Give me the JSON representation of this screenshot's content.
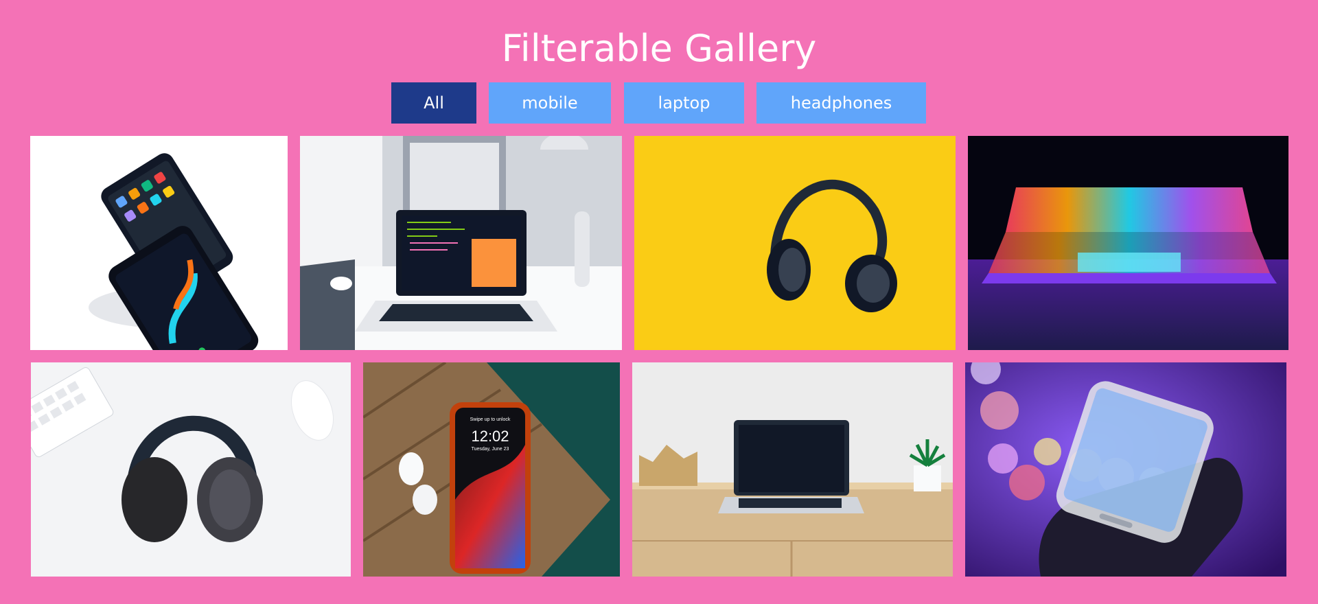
{
  "header": {
    "title": "Filterable Gallery"
  },
  "filters": [
    {
      "label": "All",
      "active": true
    },
    {
      "label": "mobile",
      "active": false
    },
    {
      "label": "laptop",
      "active": false
    },
    {
      "label": "headphones",
      "active": false
    }
  ],
  "gallery": {
    "items": [
      {
        "category": "mobile",
        "subject": "two smartphones on white"
      },
      {
        "category": "laptop",
        "subject": "laptop on desk with code"
      },
      {
        "category": "headphones",
        "subject": "headphones on yellow"
      },
      {
        "category": "laptop",
        "subject": "glowing laptop keyboard"
      },
      {
        "category": "headphones",
        "subject": "headphones with keyboard and mouse"
      },
      {
        "category": "mobile",
        "subject": "phone and earbuds on wood",
        "phone_time": "12:02",
        "phone_date": "Tuesday, June 23",
        "phone_hint": "Swipe up to unlock"
      },
      {
        "category": "laptop",
        "subject": "laptop on wooden shelf"
      },
      {
        "category": "mobile",
        "subject": "phone in hand with bokeh"
      }
    ]
  },
  "colors": {
    "background": "#f472b6",
    "active_button": "#1e3a8a",
    "inactive_button": "#60a5fa"
  }
}
